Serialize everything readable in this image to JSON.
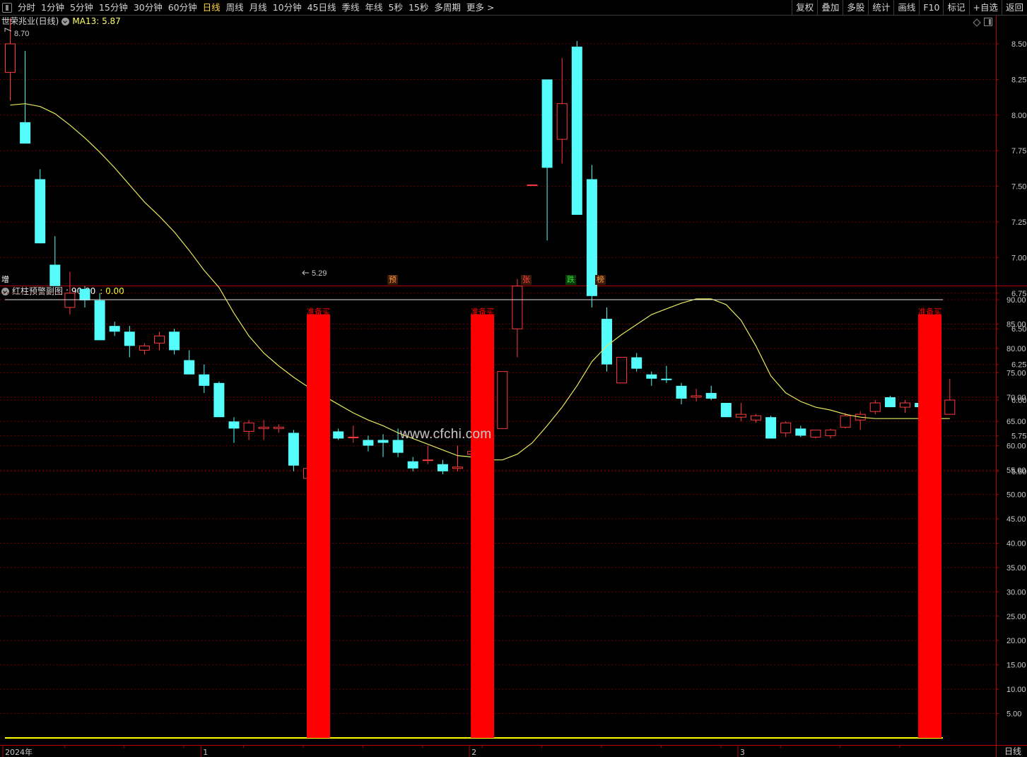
{
  "toolbar": {
    "periods": [
      "分时",
      "1分钟",
      "5分钟",
      "15分钟",
      "30分钟",
      "60分钟",
      "日线",
      "周线",
      "月线",
      "10分钟",
      "45日线",
      "季线",
      "年线",
      "5秒",
      "15秒",
      "多周期",
      "更多 >"
    ],
    "active_period": "日线",
    "right": [
      "复权",
      "叠加",
      "多股",
      "统计",
      "画线",
      "F10",
      "标记",
      "+自选",
      "返回"
    ]
  },
  "main_info": {
    "stock_name": "世荣兆业(日线)",
    "ma_label": "MA13: 5.87",
    "high_label": "8.70",
    "low_label": "5.29"
  },
  "sub_info": {
    "indicator_name": "红柱预警副图",
    "value1": ": 90.00",
    "value2": ": 0.00"
  },
  "markers": [
    {
      "label": "增",
      "color": "#ffffff"
    },
    {
      "label": "预",
      "color": "#ff9a3c"
    },
    {
      "label": "张",
      "color": "#ff4040"
    },
    {
      "label": "跌",
      "color": "#33dd33"
    },
    {
      "label": "榜",
      "color": "#ff9a3c"
    }
  ],
  "watermark": "www.cfchi.com",
  "period_label": "日线",
  "colors": {
    "up": "#ff3b3b",
    "down": "#54fcfc",
    "ma": "#e8e85a",
    "grid": "#6b0000",
    "axis": "#b30000",
    "signal_bar": "#ff0000",
    "baseline": "#ffff00"
  },
  "chart_data": [
    {
      "type": "candlestick",
      "title": "世荣兆业(日线)",
      "y_ticks": [
        "8.50",
        "8.25",
        "8.00",
        "7.75",
        "7.50",
        "7.25",
        "7.00",
        "6.75",
        "6.50",
        "6.25",
        "6.00",
        "5.75",
        "5.50"
      ],
      "ylim": [
        5.4,
        8.72
      ],
      "candles": [
        {
          "o": 8.3,
          "h": 8.68,
          "l": 8.1,
          "c": 8.5
        },
        {
          "o": 7.95,
          "h": 8.45,
          "l": 7.8,
          "c": 7.8
        },
        {
          "o": 7.55,
          "h": 7.62,
          "l": 7.1,
          "c": 7.1
        },
        {
          "o": 6.95,
          "h": 7.15,
          "l": 6.8,
          "c": 6.8
        },
        {
          "o": 6.65,
          "h": 6.9,
          "l": 6.6,
          "c": 6.75
        },
        {
          "o": 6.78,
          "h": 6.8,
          "l": 6.65,
          "c": 6.7
        },
        {
          "o": 6.7,
          "h": 6.75,
          "l": 6.42,
          "c": 6.42
        },
        {
          "o": 6.52,
          "h": 6.55,
          "l": 6.45,
          "c": 6.48
        },
        {
          "o": 6.48,
          "h": 6.52,
          "l": 6.3,
          "c": 6.38
        },
        {
          "o": 6.35,
          "h": 6.4,
          "l": 6.32,
          "c": 6.38
        },
        {
          "o": 6.4,
          "h": 6.48,
          "l": 6.35,
          "c": 6.45
        },
        {
          "o": 6.48,
          "h": 6.5,
          "l": 6.32,
          "c": 6.35
        },
        {
          "o": 6.28,
          "h": 6.35,
          "l": 6.18,
          "c": 6.18
        },
        {
          "o": 6.18,
          "h": 6.25,
          "l": 6.05,
          "c": 6.1
        },
        {
          "o": 6.12,
          "h": 6.13,
          "l": 5.88,
          "c": 5.88
        },
        {
          "o": 5.85,
          "h": 5.88,
          "l": 5.7,
          "c": 5.8
        },
        {
          "o": 5.78,
          "h": 5.86,
          "l": 5.72,
          "c": 5.84
        },
        {
          "o": 5.8,
          "h": 5.86,
          "l": 5.72,
          "c": 5.81
        },
        {
          "o": 5.8,
          "h": 5.83,
          "l": 5.77,
          "c": 5.81
        },
        {
          "o": 5.77,
          "h": 5.79,
          "l": 5.5,
          "c": 5.54
        },
        {
          "o": 5.45,
          "h": 5.55,
          "l": 5.32,
          "c": 5.52
        },
        {
          "o": 5.62,
          "h": 5.75,
          "l": 5.62,
          "c": 5.74
        },
        {
          "o": 5.78,
          "h": 5.8,
          "l": 5.72,
          "c": 5.73
        },
        {
          "o": 5.74,
          "h": 5.82,
          "l": 5.7,
          "c": 5.74
        },
        {
          "o": 5.72,
          "h": 5.75,
          "l": 5.64,
          "c": 5.68
        },
        {
          "o": 5.72,
          "h": 5.76,
          "l": 5.6,
          "c": 5.7
        },
        {
          "o": 5.72,
          "h": 5.8,
          "l": 5.6,
          "c": 5.63
        },
        {
          "o": 5.57,
          "h": 5.6,
          "l": 5.5,
          "c": 5.52
        },
        {
          "o": 5.58,
          "h": 5.68,
          "l": 5.55,
          "c": 5.58
        },
        {
          "o": 5.55,
          "h": 5.58,
          "l": 5.48,
          "c": 5.5
        },
        {
          "o": 5.52,
          "h": 5.68,
          "l": 5.5,
          "c": 5.53
        },
        {
          "o": 5.62,
          "h": 5.65,
          "l": 5.58,
          "c": 5.64
        },
        {
          "o": 5.64,
          "h": 5.72,
          "l": 5.62,
          "c": 5.7
        },
        {
          "o": 5.8,
          "h": 6.2,
          "l": 5.8,
          "c": 6.2
        },
        {
          "o": 6.5,
          "h": 6.85,
          "l": 6.3,
          "c": 6.8
        },
        {
          "o": 7.51,
          "h": 7.51,
          "l": 7.51,
          "c": 7.51
        },
        {
          "o": 8.25,
          "h": 8.25,
          "l": 7.12,
          "c": 7.63
        },
        {
          "o": 7.83,
          "h": 8.4,
          "l": 7.66,
          "c": 8.08
        },
        {
          "o": 8.48,
          "h": 8.52,
          "l": 7.3,
          "c": 7.3
        },
        {
          "o": 7.55,
          "h": 7.65,
          "l": 6.65,
          "c": 6.73
        },
        {
          "o": 6.57,
          "h": 6.65,
          "l": 6.2,
          "c": 6.25
        },
        {
          "o": 6.12,
          "h": 6.3,
          "l": 6.12,
          "c": 6.3
        },
        {
          "o": 6.3,
          "h": 6.33,
          "l": 6.2,
          "c": 6.22
        },
        {
          "o": 6.18,
          "h": 6.2,
          "l": 6.1,
          "c": 6.15
        },
        {
          "o": 6.15,
          "h": 6.24,
          "l": 6.12,
          "c": 6.14
        },
        {
          "o": 6.1,
          "h": 6.12,
          "l": 5.97,
          "c": 6.01
        },
        {
          "o": 6.02,
          "h": 6.08,
          "l": 5.99,
          "c": 6.03
        },
        {
          "o": 6.05,
          "h": 6.1,
          "l": 6.0,
          "c": 6.01
        },
        {
          "o": 5.98,
          "h": 5.98,
          "l": 5.88,
          "c": 5.88
        },
        {
          "o": 5.88,
          "h": 5.98,
          "l": 5.85,
          "c": 5.9
        },
        {
          "o": 5.86,
          "h": 5.9,
          "l": 5.84,
          "c": 5.89
        },
        {
          "o": 5.88,
          "h": 5.89,
          "l": 5.73,
          "c": 5.73
        },
        {
          "o": 5.77,
          "h": 5.85,
          "l": 5.74,
          "c": 5.84
        },
        {
          "o": 5.8,
          "h": 5.82,
          "l": 5.74,
          "c": 5.75
        },
        {
          "o": 5.74,
          "h": 5.79,
          "l": 5.73,
          "c": 5.79
        },
        {
          "o": 5.75,
          "h": 5.8,
          "l": 5.73,
          "c": 5.79
        },
        {
          "o": 5.81,
          "h": 5.91,
          "l": 5.8,
          "c": 5.89
        },
        {
          "o": 5.86,
          "h": 5.92,
          "l": 5.79,
          "c": 5.9
        },
        {
          "o": 5.92,
          "h": 6.0,
          "l": 5.9,
          "c": 5.98
        },
        {
          "o": 6.02,
          "h": 6.03,
          "l": 5.95,
          "c": 5.95
        },
        {
          "o": 5.95,
          "h": 6.0,
          "l": 5.91,
          "c": 5.98
        },
        {
          "o": 5.98,
          "h": 5.98,
          "l": 5.94,
          "c": 5.95
        },
        {
          "o": 5.92,
          "h": 5.93,
          "l": 5.9,
          "c": 5.92
        },
        {
          "o": 5.9,
          "h": 6.15,
          "l": 5.9,
          "c": 6.0
        }
      ],
      "ma": {
        "name": "MA13",
        "values": [
          8.07,
          8.08,
          8.06,
          8.01,
          7.93,
          7.84,
          7.74,
          7.63,
          7.51,
          7.39,
          7.29,
          7.18,
          7.05,
          6.91,
          6.79,
          6.61,
          6.45,
          6.33,
          6.24,
          6.16,
          6.09,
          6.03,
          5.97,
          5.91,
          5.86,
          5.82,
          5.77,
          5.73,
          5.69,
          5.65,
          5.61,
          5.6,
          5.58,
          5.58,
          5.62,
          5.7,
          5.82,
          5.95,
          6.1,
          6.27,
          6.38,
          6.46,
          6.53,
          6.6,
          6.64,
          6.68,
          6.71,
          6.71,
          6.67,
          6.56,
          6.38,
          6.17,
          6.05,
          5.99,
          5.95,
          5.93,
          5.9,
          5.88,
          5.87,
          5.87,
          5.87,
          5.87,
          5.87,
          5.87
        ]
      }
    },
    {
      "type": "bar",
      "title": "红柱预警副图",
      "y_ticks": [
        "90.00",
        "85.00",
        "80.00",
        "75.00",
        "70.00",
        "65.00",
        "60.00",
        "55.00",
        "50.00",
        "45.00",
        "40.00",
        "35.00",
        "30.00",
        "25.00",
        "20.00",
        "15.00",
        "10.00",
        "5.00"
      ],
      "ylim": [
        0,
        90
      ],
      "reference_line": 90,
      "baseline": 0,
      "bars": [
        {
          "index": 20,
          "value": 87,
          "label": "准备买"
        },
        {
          "index": 31,
          "value": 87,
          "label": "准备买"
        },
        {
          "index": 61,
          "value": 87,
          "label": "准备买"
        }
      ]
    }
  ],
  "x_axis": {
    "labels": [
      {
        "index": 0,
        "text": "2024年"
      },
      {
        "index": 13,
        "text": "1"
      },
      {
        "index": 31,
        "text": "2"
      },
      {
        "index": 49,
        "text": "3"
      }
    ]
  }
}
